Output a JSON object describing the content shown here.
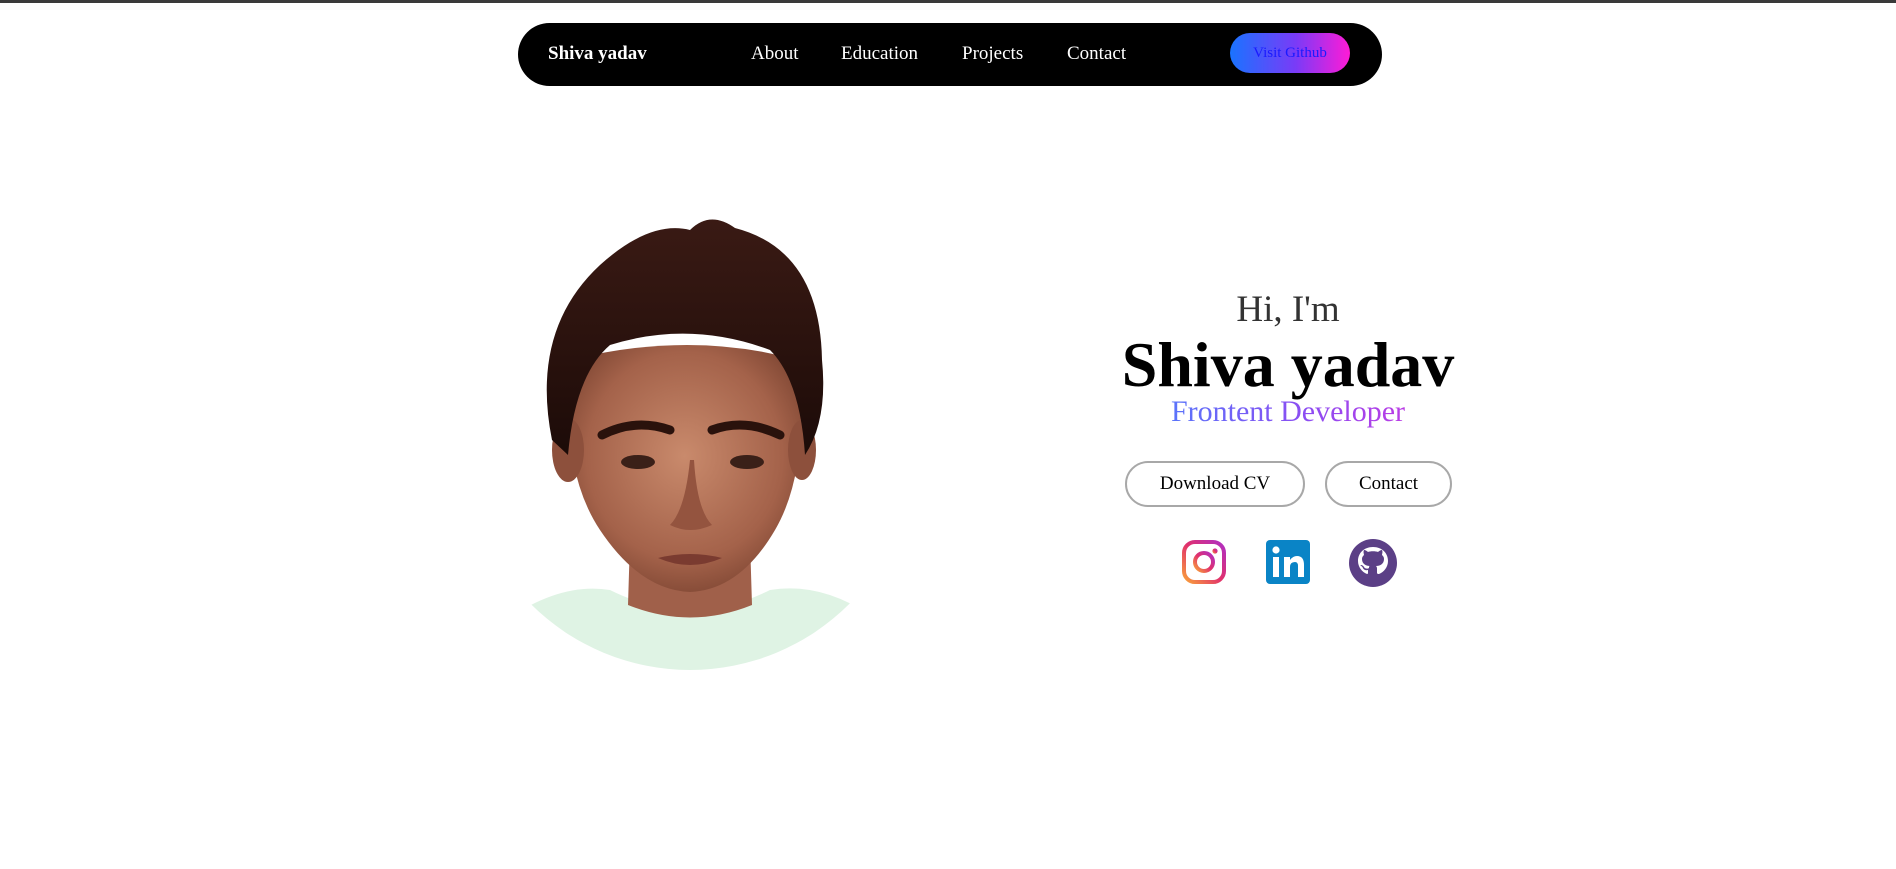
{
  "nav": {
    "brand": "Shiva yadav",
    "links": [
      "About",
      "Education",
      "Projects",
      "Contact"
    ],
    "cta_label": "Visit Github"
  },
  "hero": {
    "greeting": "Hi, I'm",
    "name": "Shiva yadav",
    "role": "Frontent Developer",
    "download_label": "Download CV",
    "contact_label": "Contact"
  },
  "socials": [
    {
      "icon": "instagram-icon",
      "color": "#e1306c"
    },
    {
      "icon": "linkedin-icon",
      "color": "#0a84c6"
    },
    {
      "icon": "github-icon",
      "color": "#5b3f86"
    }
  ],
  "colors": {
    "nav_bg": "#000000",
    "accent_start": "#1a73ff",
    "accent_mid": "#7a3bf7",
    "accent_end": "#ff1bd6"
  }
}
